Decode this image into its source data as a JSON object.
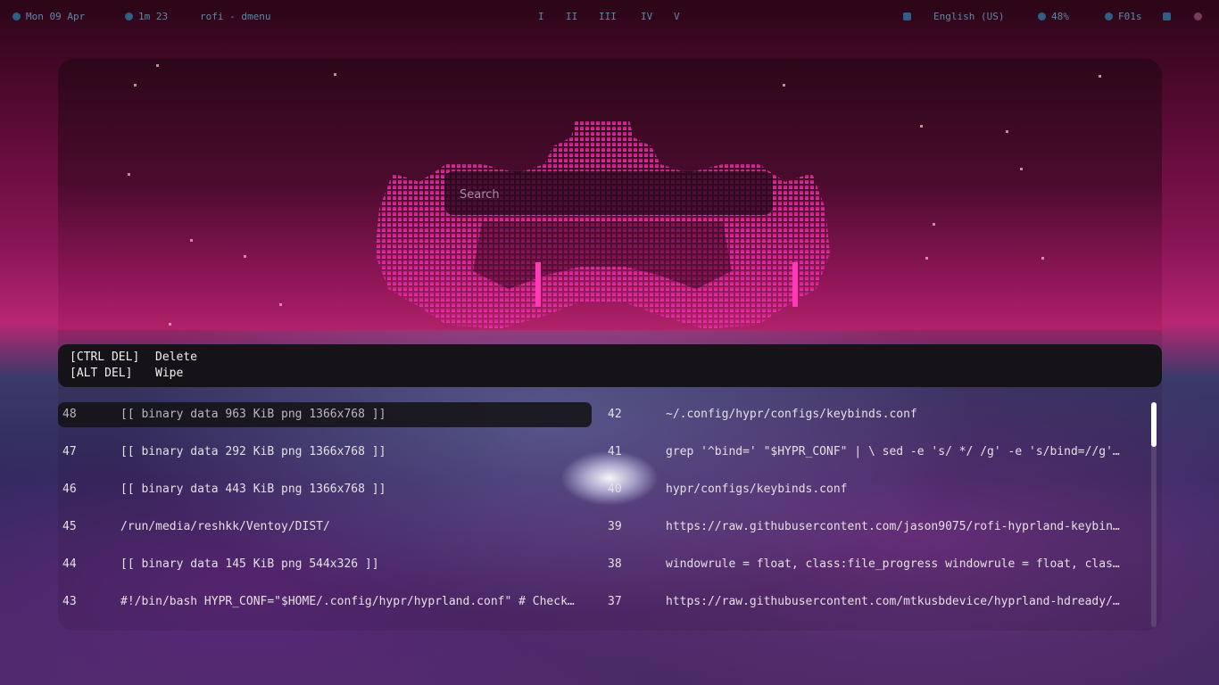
{
  "topbar": {
    "left": [
      {
        "label": "Mon 09 Apr",
        "icon": "calendar-icon"
      },
      {
        "label": "1m 23",
        "icon": "clock-icon"
      },
      {
        "label": "rofi - dmenu",
        "icon": ""
      }
    ],
    "workspaces": [
      "I",
      "II",
      "III",
      "IV",
      "V"
    ],
    "right": [
      {
        "label": "",
        "icon": "clipboard-icon"
      },
      {
        "label": "English (US)",
        "icon": ""
      },
      {
        "label": "48%",
        "icon": "volume-icon"
      },
      {
        "label": "F01s",
        "icon": "wifi-icon"
      },
      {
        "label": "",
        "icon": "screen-icon"
      },
      {
        "label": "",
        "icon": "power-icon"
      }
    ]
  },
  "search": {
    "placeholder": "Search",
    "value": ""
  },
  "help": [
    {
      "key": "[CTRL DEL]",
      "action": "Delete"
    },
    {
      "key": "[ALT DEL]",
      "action": "Wipe"
    }
  ],
  "list": {
    "left": [
      {
        "num": "48",
        "text": "[[ binary data 963 KiB png 1366x768 ]]",
        "selected": true
      },
      {
        "num": "47",
        "text": "[[ binary data 292 KiB png 1366x768 ]]"
      },
      {
        "num": "46",
        "text": "[[ binary data 443 KiB png 1366x768 ]]"
      },
      {
        "num": "45",
        "text": "/run/media/reshkk/Ventoy/DIST/"
      },
      {
        "num": "44",
        "text": "[[ binary data 145 KiB png 544x326 ]]"
      },
      {
        "num": "43",
        "text": "#!/bin/bash HYPR_CONF=\"$HOME/.config/hypr/hyprland.conf\" # Check…"
      }
    ],
    "right": [
      {
        "num": "42",
        "text": "~/.config/hypr/configs/keybinds.conf"
      },
      {
        "num": "41",
        "text": "grep '^bind=' \"$HYPR_CONF\" | \\ sed -e 's/ */ /g' -e 's/bind=//g'…"
      },
      {
        "num": "40",
        "text": "hypr/configs/keybinds.conf"
      },
      {
        "num": "39",
        "text": "https://raw.githubusercontent.com/jason9075/rofi-hyprland-keybin…"
      },
      {
        "num": "38",
        "text": "windowrule = float, class:file_progress windowrule = float, clas…"
      },
      {
        "num": "37",
        "text": "https://raw.githubusercontent.com/mtkusbdevice/hyprland-hdready/…"
      }
    ]
  },
  "scrollbar": {
    "position_fraction": 0.0
  }
}
